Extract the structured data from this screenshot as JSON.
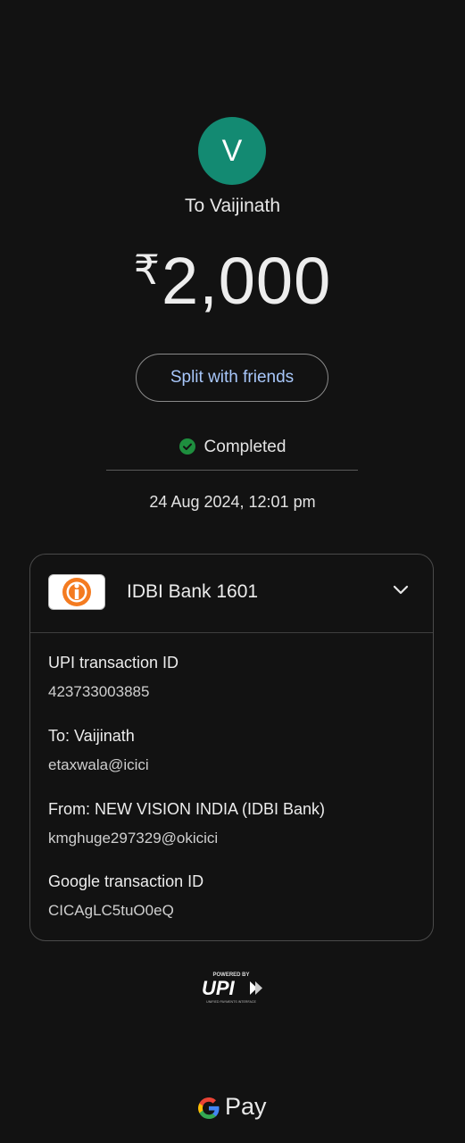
{
  "recipient": {
    "avatar_letter": "V",
    "avatar_color": "#138a72",
    "to_label": "To Vaijinath"
  },
  "payment": {
    "currency_symbol": "₹",
    "amount": "2,000"
  },
  "split_button": {
    "label": "Split with friends"
  },
  "status": {
    "text": "Completed",
    "color": "#1e8e3e"
  },
  "timestamp": "24 Aug 2024, 12:01 pm",
  "card": {
    "bank_name": "IDBI Bank 1601",
    "details": [
      {
        "label": "UPI transaction ID",
        "value": "423733003885"
      },
      {
        "label": "To: Vaijinath",
        "value": "etaxwala@icici"
      },
      {
        "label": "From: NEW VISION INDIA (IDBI Bank)",
        "value": "kmghuge297329@okicici"
      },
      {
        "label": "Google transaction ID",
        "value": "CICAgLC5tuO0eQ"
      }
    ]
  },
  "footer": {
    "upi_powered_by": "POWERED BY",
    "upi_wordmark": "UPI",
    "upi_tagline": "UNIFIED PAYMENTS INTERFACE",
    "gpay_label": "Pay"
  }
}
